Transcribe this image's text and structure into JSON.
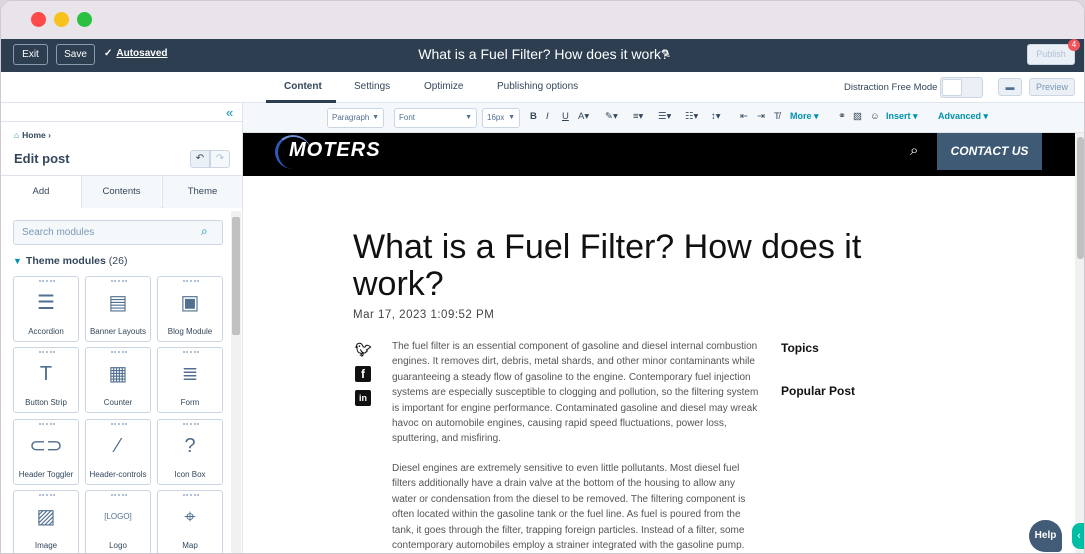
{
  "header": {
    "exit_label": "Exit",
    "save_label": "Save",
    "autosaved_label": "Autosaved",
    "document_title": "What is a Fuel Filter? How does it work?",
    "publish_label": "Publish",
    "notification_count": "4"
  },
  "tabs": {
    "items": [
      {
        "label": "Content"
      },
      {
        "label": "Settings"
      },
      {
        "label": "Optimize"
      },
      {
        "label": "Publishing options"
      }
    ],
    "active": "Content",
    "distraction_free_label": "Distraction Free Mode",
    "preview_label": "Preview"
  },
  "sidebar": {
    "breadcrumb": "Home",
    "title": "Edit post",
    "tabs": [
      {
        "label": "Add"
      },
      {
        "label": "Contents"
      },
      {
        "label": "Theme"
      }
    ],
    "search_placeholder": "Search modules",
    "section_title": "Theme modules",
    "section_count": "(26)",
    "modules": [
      {
        "label": "Accordion",
        "icon": "accordion-icon"
      },
      {
        "label": "Banner Layouts",
        "icon": "banner-icon"
      },
      {
        "label": "Blog Module",
        "icon": "blog-module-icon"
      },
      {
        "label": "Button Strip",
        "icon": "text-icon"
      },
      {
        "label": "Counter",
        "icon": "counter-icon"
      },
      {
        "label": "Form",
        "icon": "form-icon"
      },
      {
        "label": "Header Toggler",
        "icon": "toggle-icon"
      },
      {
        "label": "Header-controls",
        "icon": "magic-wand-icon"
      },
      {
        "label": "Icon Box",
        "icon": "question-icon"
      },
      {
        "label": "Image",
        "icon": "image-icon"
      },
      {
        "label": "Logo",
        "icon": "logo-icon"
      },
      {
        "label": "Map",
        "icon": "map-icon"
      }
    ]
  },
  "toolbar": {
    "paragraph": "Paragraph",
    "font": "Font",
    "size": "16px",
    "more": "More",
    "insert": "Insert",
    "advanced": "Advanced"
  },
  "site": {
    "logo_text": "MOTERS",
    "contact_label": "CONTACT US"
  },
  "post": {
    "title": "What is a Fuel Filter? How does it work?",
    "date": "Mar 17, 2023 1:09:52 PM",
    "paragraph1": "The fuel filter is an essential component of gasoline and diesel internal combustion engines. It removes dirt, debris, metal shards, and other minor contaminants while guaranteeing a steady flow of gasoline to the engine. Contemporary fuel injection systems are especially susceptible to clogging and pollution, so the filtering system is important for engine performance. Contaminated gasoline and diesel may wreak havoc on automobile engines, causing rapid speed fluctuations, power loss, sputtering, and misfiring.",
    "paragraph2": "Diesel engines are extremely sensitive to even little pollutants. Most diesel fuel filters additionally have a drain valve at the bottom of the housing to allow any water or condensation from the diesel to be removed. The filtering component is often located within the gasoline tank or the fuel line. As fuel is poured from the tank, it goes through the filter, trapping foreign particles. Instead of a filter, some contemporary automobiles employ a strainer integrated with the gasoline pump.",
    "topics_label": "Topics",
    "popular_label": "Popular Post"
  },
  "help_label": "Help"
}
